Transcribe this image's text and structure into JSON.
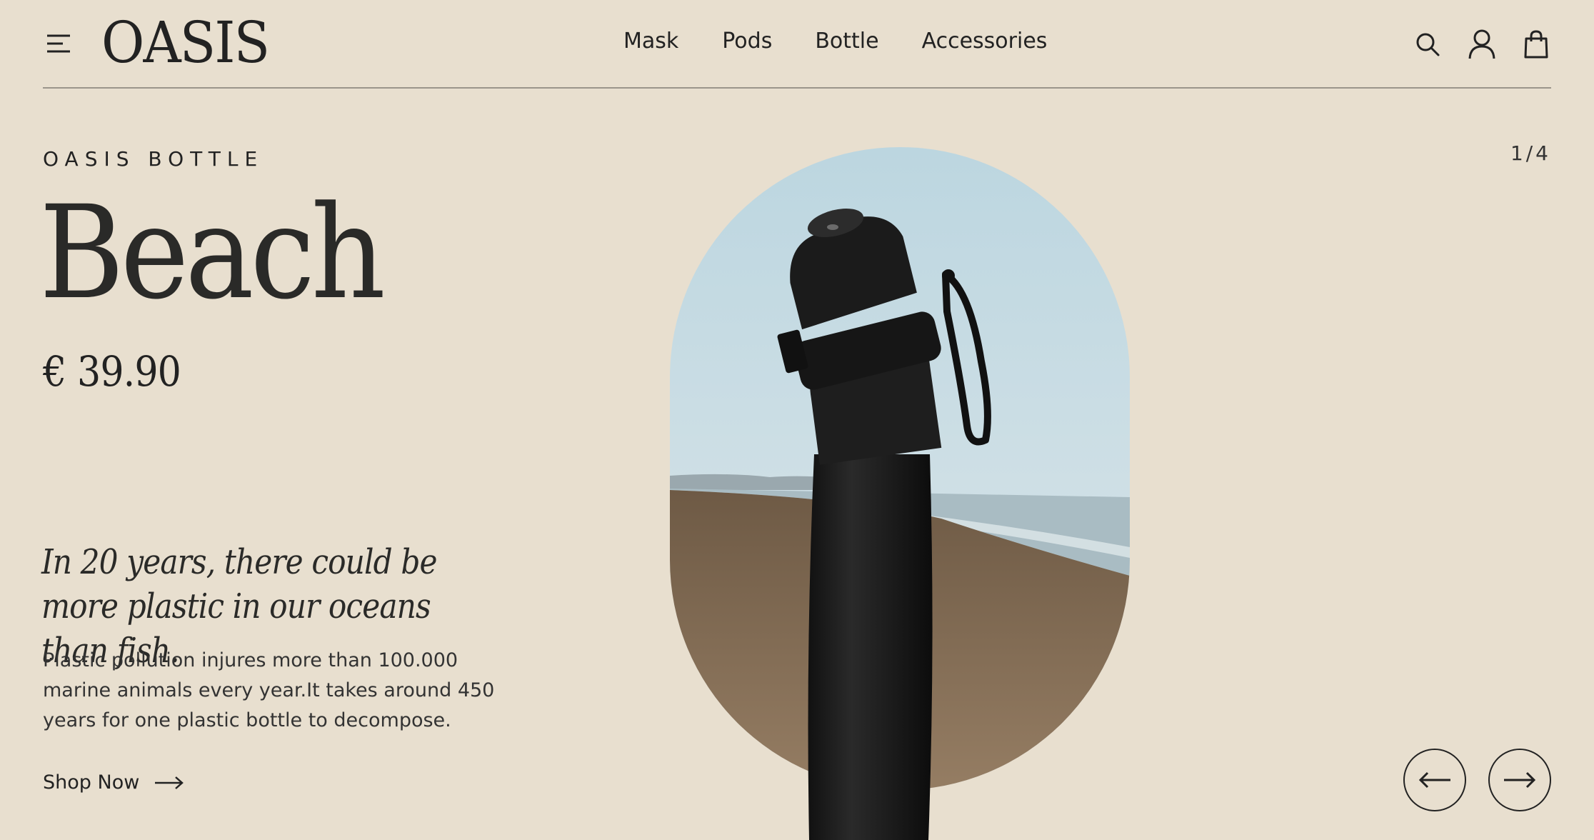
{
  "brand": {
    "logo_text": "OASIS"
  },
  "nav": {
    "items": [
      "Mask",
      "Pods",
      "Bottle",
      "Accessories"
    ]
  },
  "header_icons": [
    "menu-icon",
    "search-icon",
    "user-icon",
    "bag-icon"
  ],
  "hero": {
    "eyebrow": "OASIS BOTTLE",
    "title": "Beach",
    "price": "€ 39.90",
    "quote": "In 20 years, there could be more plastic in our oceans than fish.",
    "body": "Plastic pollution injures more than 100.000 marine animals every year.It takes around 450 years for one plastic bottle to decompose.",
    "cta": "Shop Now",
    "slide_counter": "1/4"
  },
  "colors": {
    "background": "#e8dfcf",
    "text": "#222222",
    "sky": "#c6dbe2",
    "sand": "#8a7560",
    "bottle": "#1c1c1c"
  }
}
